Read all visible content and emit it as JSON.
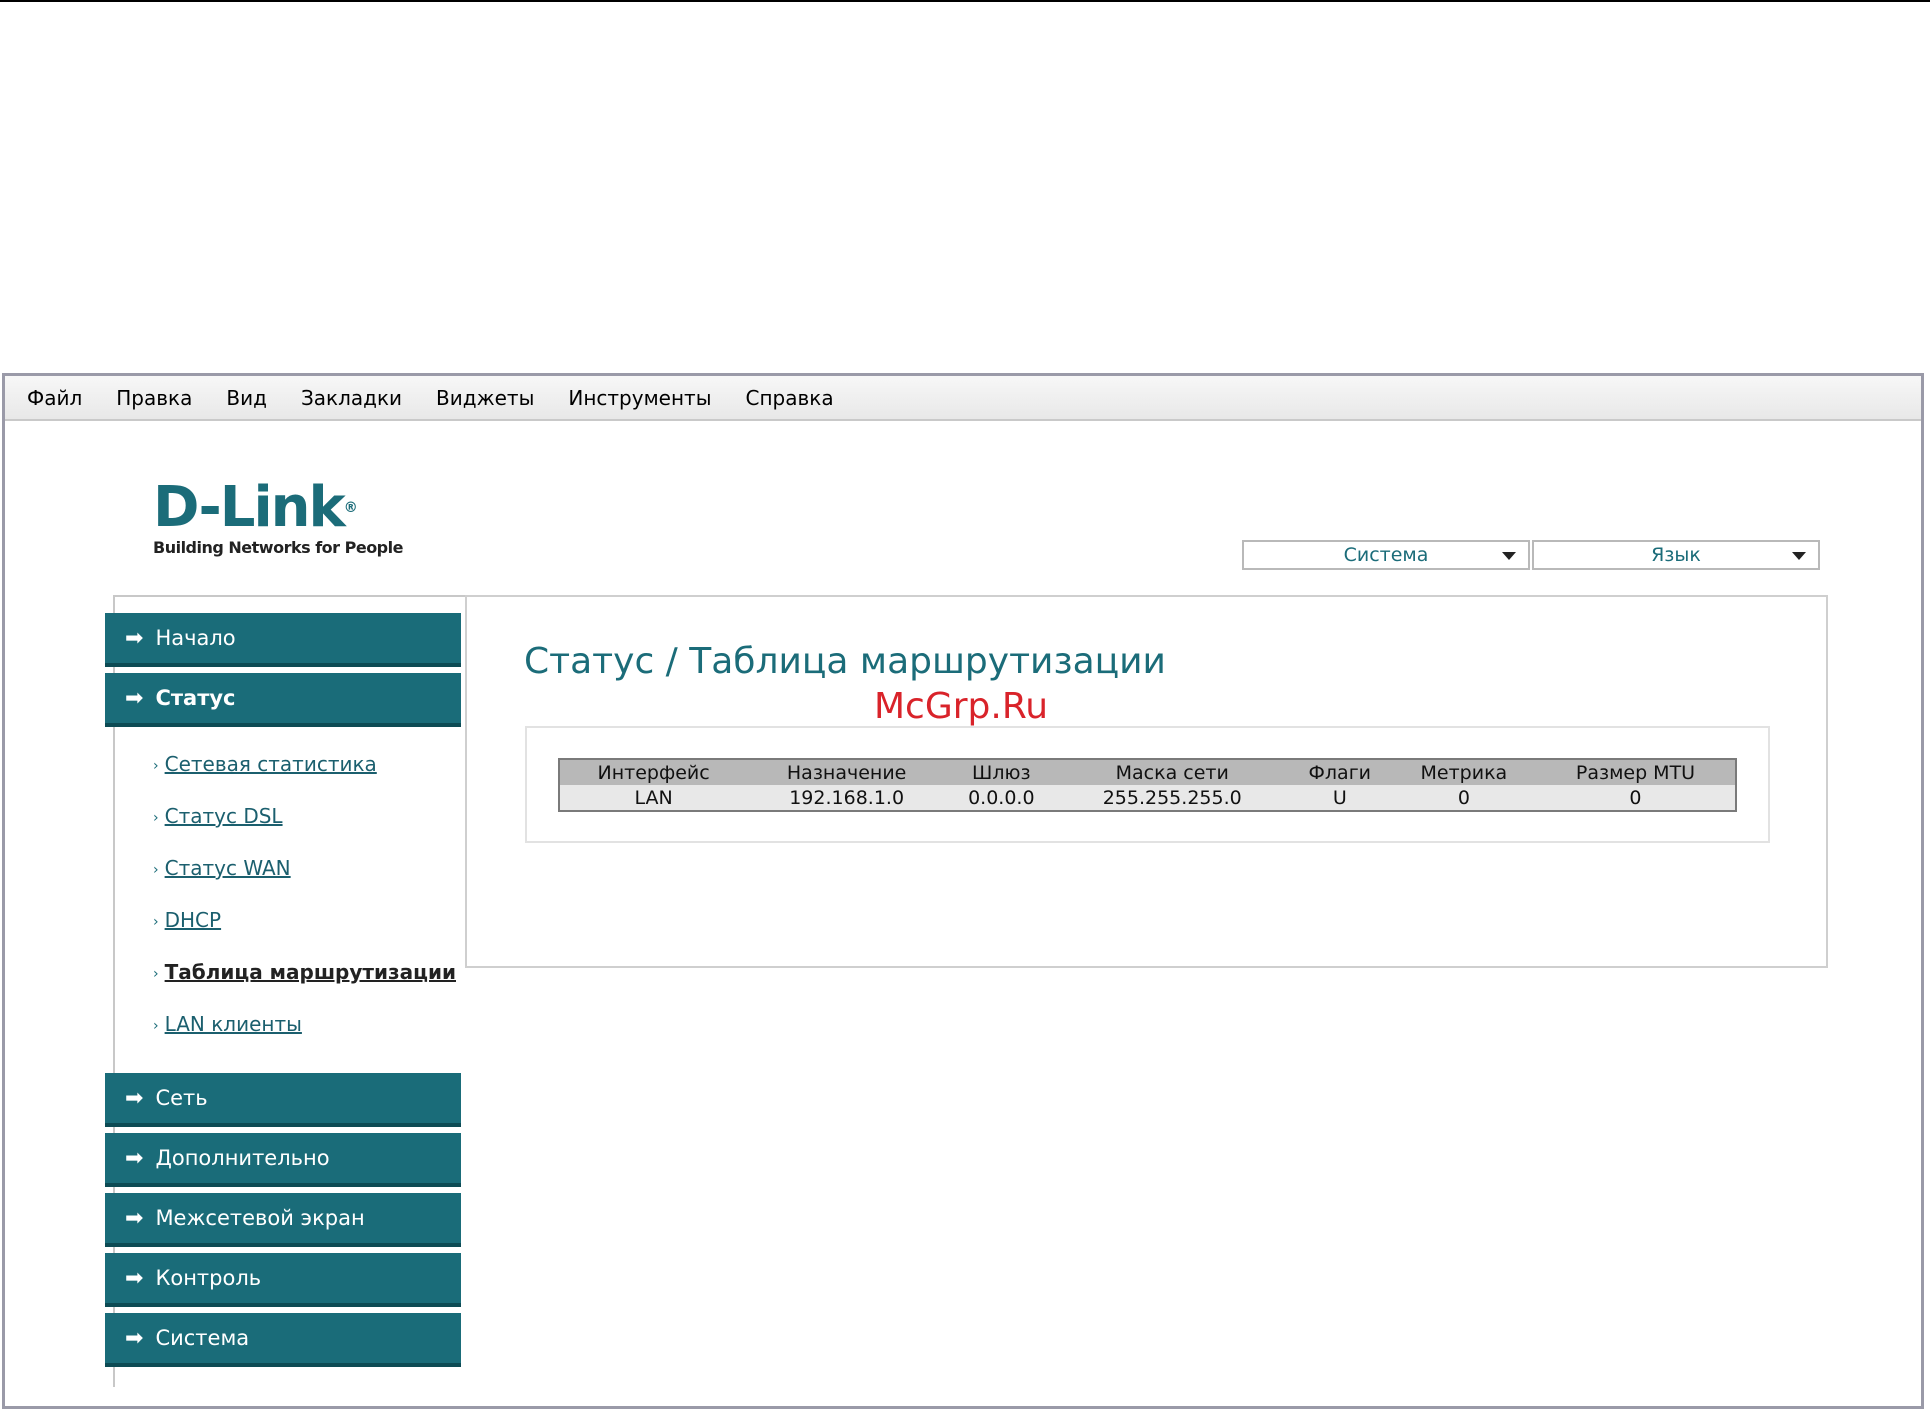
{
  "menubar": {
    "items": [
      {
        "label": "Файл"
      },
      {
        "label": "Правка"
      },
      {
        "label": "Вид"
      },
      {
        "label": "Закладки"
      },
      {
        "label": "Виджеты"
      },
      {
        "label": "Инструменты"
      },
      {
        "label": "Справка"
      }
    ]
  },
  "logo": {
    "name": "D-Link",
    "tagline": "Building Networks for People"
  },
  "header": {
    "system_select": "Система",
    "language_select": "Язык"
  },
  "sidebar": {
    "nav": [
      {
        "label": "Начало"
      },
      {
        "label": "Статус"
      },
      {
        "label": "Сеть"
      },
      {
        "label": "Дополнительно"
      },
      {
        "label": "Межсетевой экран"
      },
      {
        "label": "Контроль"
      },
      {
        "label": "Система"
      }
    ],
    "status_submenu": [
      {
        "label": "Сетевая статистика"
      },
      {
        "label": "Статус DSL"
      },
      {
        "label": "Статус WAN"
      },
      {
        "label": "DHCP"
      },
      {
        "label": "Таблица маршрутизации"
      },
      {
        "label": "LAN клиенты"
      }
    ]
  },
  "main": {
    "title": "Статус / Таблица маршрутизации",
    "watermark": "McGrp.Ru",
    "table": {
      "headers": [
        "Интерфейс",
        "Назначение",
        "Шлюз",
        "Маска сети",
        "Флаги",
        "Метрика",
        "Размер MTU"
      ],
      "rows": [
        [
          "LAN",
          "192.168.1.0",
          "0.0.0.0",
          "255.255.255.0",
          "U",
          "0",
          "0"
        ]
      ]
    }
  },
  "colors": {
    "accent": "#1a6c79",
    "watermark": "#d9232a"
  }
}
